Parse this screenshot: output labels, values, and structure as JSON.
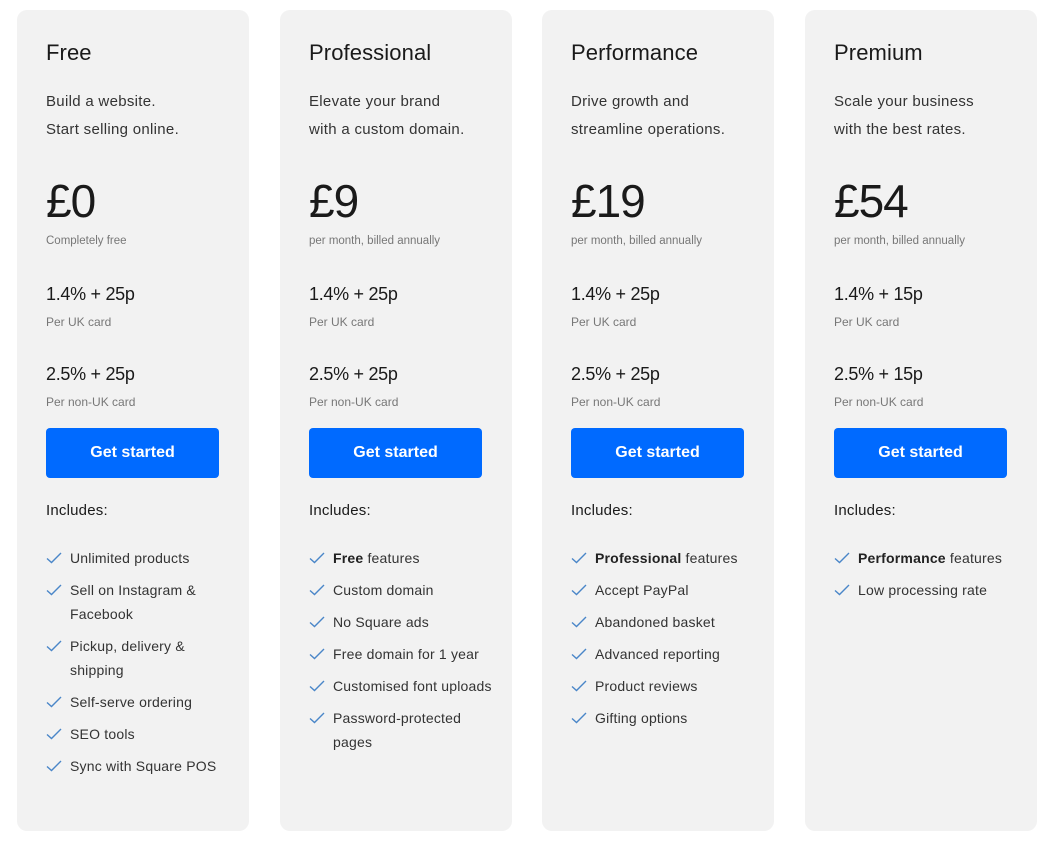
{
  "theme": {
    "accent": "#006aff",
    "card_bg": "#f2f2f2",
    "check_color": "#4a86c8"
  },
  "plans": [
    {
      "name": "Free",
      "description": [
        "Build a website.",
        "Start selling online."
      ],
      "price": "£0",
      "price_note": "Completely free",
      "rates": [
        {
          "value": "1.4% + 25p",
          "note": "Per UK card"
        },
        {
          "value": "2.5% + 25p",
          "note": "Per non-UK card"
        }
      ],
      "cta": "Get started",
      "includes_label": "Includes:",
      "features": [
        {
          "bold": "",
          "text": "Unlimited products"
        },
        {
          "bold": "",
          "text": "Sell on Instagram & Facebook"
        },
        {
          "bold": "",
          "text": "Pickup, delivery & shipping"
        },
        {
          "bold": "",
          "text": "Self-serve ordering"
        },
        {
          "bold": "",
          "text": "SEO tools"
        },
        {
          "bold": "",
          "text": "Sync with Square POS"
        }
      ]
    },
    {
      "name": "Professional",
      "description": [
        "Elevate your brand",
        "with a custom domain."
      ],
      "price": "£9",
      "price_note": "per month, billed annually",
      "rates": [
        {
          "value": "1.4% + 25p",
          "note": "Per UK card"
        },
        {
          "value": "2.5% + 25p",
          "note": "Per non-UK card"
        }
      ],
      "cta": "Get started",
      "includes_label": "Includes:",
      "features": [
        {
          "bold": "Free",
          "text": " features"
        },
        {
          "bold": "",
          "text": "Custom domain"
        },
        {
          "bold": "",
          "text": "No Square ads"
        },
        {
          "bold": "",
          "text": "Free domain for 1 year"
        },
        {
          "bold": "",
          "text": "Customised font uploads"
        },
        {
          "bold": "",
          "text": "Password-protected pages"
        }
      ]
    },
    {
      "name": "Performance",
      "description": [
        "Drive growth and",
        "streamline operations."
      ],
      "price": "£19",
      "price_note": "per month, billed annually",
      "rates": [
        {
          "value": "1.4% + 25p",
          "note": "Per UK card"
        },
        {
          "value": "2.5% + 25p",
          "note": "Per non-UK card"
        }
      ],
      "cta": "Get started",
      "includes_label": "Includes:",
      "features": [
        {
          "bold": "Professional",
          "text": " features"
        },
        {
          "bold": "",
          "text": "Accept PayPal"
        },
        {
          "bold": "",
          "text": "Abandoned basket"
        },
        {
          "bold": "",
          "text": "Advanced reporting"
        },
        {
          "bold": "",
          "text": "Product reviews"
        },
        {
          "bold": "",
          "text": "Gifting options"
        }
      ]
    },
    {
      "name": "Premium",
      "description": [
        "Scale your business",
        "with the best rates."
      ],
      "price": "£54",
      "price_note": "per month, billed annually",
      "rates": [
        {
          "value": "1.4% + 15p",
          "note": "Per UK card"
        },
        {
          "value": "2.5% + 15p",
          "note": "Per non-UK card"
        }
      ],
      "cta": "Get started",
      "includes_label": "Includes:",
      "features": [
        {
          "bold": "Performance",
          "text": " features"
        },
        {
          "bold": "",
          "text": "Low processing rate"
        }
      ]
    }
  ]
}
